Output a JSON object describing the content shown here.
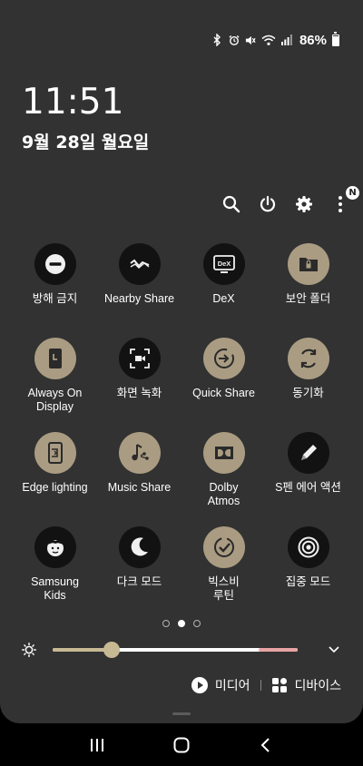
{
  "status_bar": {
    "icons": [
      "bluetooth-icon",
      "alarm-icon",
      "mute-icon",
      "wifi-icon",
      "signal-icon"
    ],
    "battery_percent": "86%",
    "battery_level": 0.86
  },
  "clock": {
    "time": "11:51",
    "date": "9월 28일 월요일"
  },
  "top_actions": {
    "icons": [
      "search-icon",
      "power-icon",
      "settings-icon",
      "more-icon"
    ],
    "notification_badge": "N"
  },
  "tiles": [
    {
      "label": "방해 금지",
      "icon": "do-not-disturb-icon",
      "active": false
    },
    {
      "label": "Nearby Share",
      "icon": "nearby-share-icon",
      "active": false
    },
    {
      "label": "DeX",
      "icon": "dex-icon",
      "active": false
    },
    {
      "label": "보안 폴더",
      "icon": "secure-folder-icon",
      "active": true
    },
    {
      "label": "Always On\nDisplay",
      "icon": "always-on-display-icon",
      "active": true
    },
    {
      "label": "화면 녹화",
      "icon": "screen-recorder-icon",
      "active": false
    },
    {
      "label": "Quick Share",
      "icon": "quick-share-icon",
      "active": true
    },
    {
      "label": "동기화",
      "icon": "sync-icon",
      "active": true
    },
    {
      "label": "Edge lighting",
      "icon": "edge-lighting-icon",
      "active": true
    },
    {
      "label": "Music Share",
      "icon": "music-share-icon",
      "active": true
    },
    {
      "label": "Dolby\nAtmos",
      "icon": "dolby-atmos-icon",
      "active": true
    },
    {
      "label": "S펜 에어 액션",
      "icon": "s-pen-icon",
      "active": false
    },
    {
      "label": "Samsung\nKids",
      "icon": "samsung-kids-icon",
      "active": false
    },
    {
      "label": "다크 모드",
      "icon": "dark-mode-icon",
      "active": false
    },
    {
      "label": "빅스비\n루틴",
      "icon": "bixby-routines-icon",
      "active": true
    },
    {
      "label": "집중 모드",
      "icon": "focus-mode-icon",
      "active": false
    }
  ],
  "pager": {
    "pages": 3,
    "current": 2
  },
  "brightness": {
    "level": 0.24
  },
  "media": {
    "label": "미디어",
    "icon": "play-icon"
  },
  "devices": {
    "label": "디바이스",
    "icon": "devices-grid-icon"
  },
  "nav": {
    "icons": [
      "recents-icon",
      "home-icon",
      "back-icon"
    ]
  },
  "colors": {
    "panel_bg": "#323232",
    "tile_on": "#aa9c82",
    "tile_off": "#121212",
    "slider_accent": "#c7b993"
  }
}
